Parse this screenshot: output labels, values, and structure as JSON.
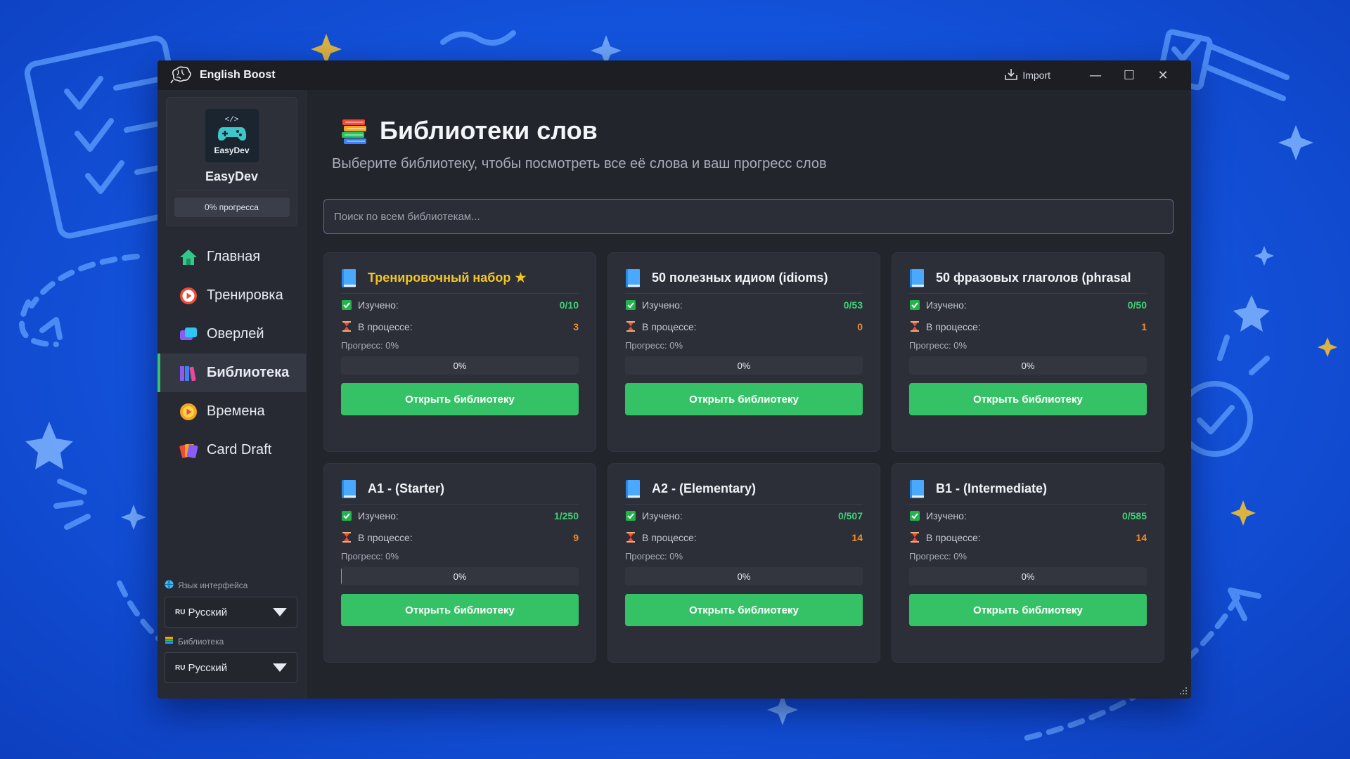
{
  "window": {
    "title": "English Boost",
    "import_label": "Import",
    "minimize": "—",
    "maximize": "☐",
    "close": "✕"
  },
  "profile": {
    "avatar_code": "</>",
    "avatar_brand": "EasyDev",
    "name": "EasyDev",
    "progress": "0% прогресса"
  },
  "nav": [
    {
      "label": "Главная",
      "icon": "home-icon"
    },
    {
      "label": "Тренировка",
      "icon": "play-icon"
    },
    {
      "label": "Оверлей",
      "icon": "overlay-icon"
    },
    {
      "label": "Библиотека",
      "icon": "books-icon",
      "active": true
    },
    {
      "label": "Времена",
      "icon": "clock-icon"
    },
    {
      "label": "Card Draft",
      "icon": "cards-icon"
    }
  ],
  "settings": {
    "interface_lang_label": "Язык интерфейса",
    "interface_lang_flag": "RU",
    "interface_lang_value": "Русский",
    "library_label": "Библиотека",
    "library_flag": "RU",
    "library_value": "Русский"
  },
  "page": {
    "title": "Библиотеки слов",
    "subtitle": "Выберите библиотеку, чтобы посмотреть все её слова и ваш прогресс слов",
    "search_placeholder": "Поиск по всем библиотекам..."
  },
  "card_labels": {
    "learned": "Изучено:",
    "in_progress": "В процессе:",
    "open": "Открыть библиотеку"
  },
  "libraries": [
    {
      "title": "Тренировочный набор",
      "featured": true,
      "star": "★",
      "learned": "0/10",
      "in_progress": "3",
      "progress_label": "Прогресс: 0%",
      "progress_text": "0%",
      "progress": 0
    },
    {
      "title": "50 полезных идиом (idioms)",
      "featured": false,
      "learned": "0/53",
      "in_progress": "0",
      "progress_label": "Прогресс: 0%",
      "progress_text": "0%",
      "progress": 0
    },
    {
      "title": "50 фразовых глаголов (phrasal",
      "featured": false,
      "learned": "0/50",
      "in_progress": "1",
      "progress_label": "Прогресс: 0%",
      "progress_text": "0%",
      "progress": 0
    },
    {
      "title": "A1 - (Starter)",
      "featured": false,
      "learned": "1/250",
      "in_progress": "9",
      "progress_label": "Прогресс: 0%",
      "progress_text": "0%",
      "progress": 0.004
    },
    {
      "title": "A2 - (Elementary)",
      "featured": false,
      "learned": "0/507",
      "in_progress": "14",
      "progress_label": "Прогресс: 0%",
      "progress_text": "0%",
      "progress": 0
    },
    {
      "title": "B1 - (Intermediate)",
      "featured": false,
      "learned": "0/585",
      "in_progress": "14",
      "progress_label": "Прогресс: 0%",
      "progress_text": "0%",
      "progress": 0
    }
  ],
  "colors": {
    "accent_green": "#35c267",
    "learned_green": "#3fd177",
    "progress_orange": "#f08d2d",
    "featured_gold": "#f3c623",
    "background_blue": "#1456e0"
  }
}
